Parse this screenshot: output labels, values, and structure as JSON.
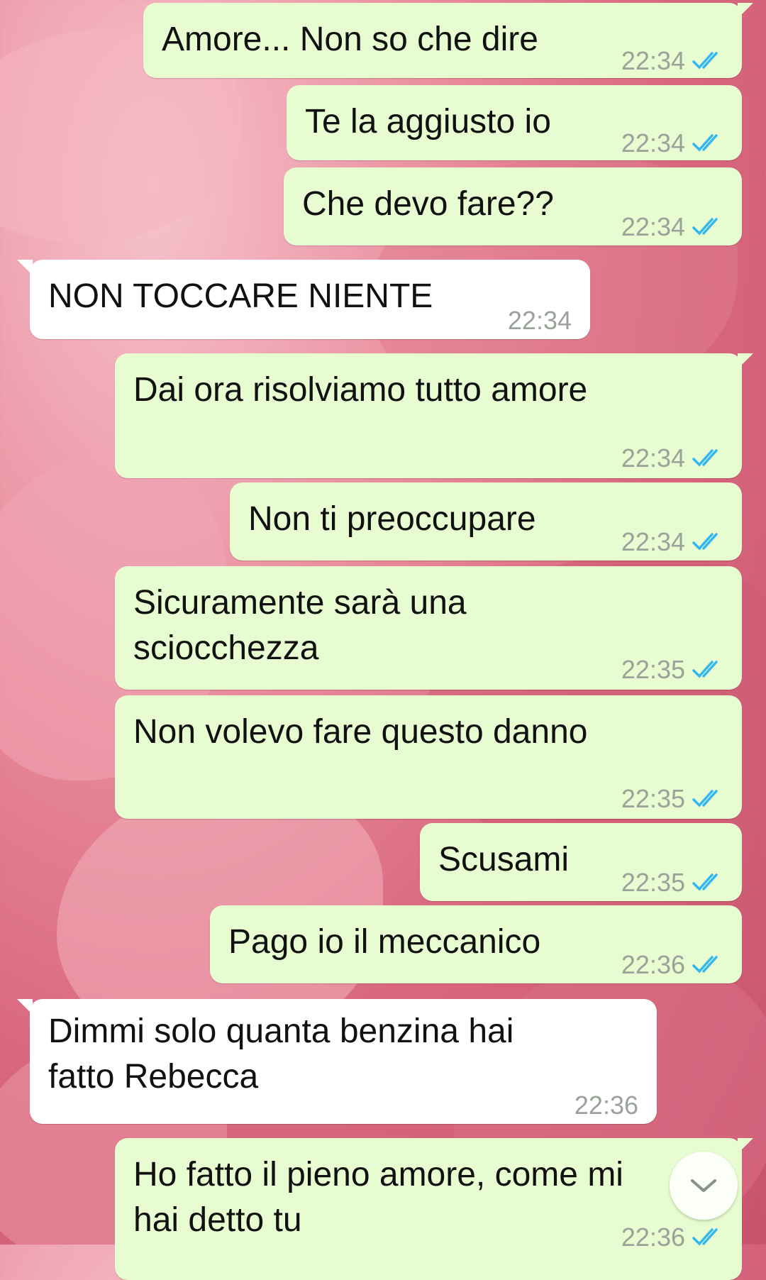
{
  "colors": {
    "outgoing": "#e7fcd1",
    "incoming": "#ffffff",
    "tick": "#34b7f1",
    "time": "#9aa29a"
  },
  "messages": [
    {
      "text": "Amore... Non so che dire",
      "time": "22:34",
      "dir": "out",
      "status": "double-check-read-icon"
    },
    {
      "text": "Te la aggiusto io",
      "time": "22:34",
      "dir": "out",
      "status": "double-check-read-icon"
    },
    {
      "text": "Che devo fare??",
      "time": "22:34",
      "dir": "out",
      "status": "double-check-read-icon"
    },
    {
      "text": "NON TOCCARE NIENTE",
      "time": "22:34",
      "dir": "in"
    },
    {
      "text": "Dai ora risolviamo tutto amore",
      "time": "22:34",
      "dir": "out",
      "status": "double-check-read-icon"
    },
    {
      "text": "Non ti preoccupare",
      "time": "22:34",
      "dir": "out",
      "status": "double-check-read-icon"
    },
    {
      "text": "Sicuramente sarà una\nsciocchezza",
      "time": "22:35",
      "dir": "out",
      "status": "double-check-read-icon"
    },
    {
      "text": "Non volevo fare questo danno",
      "time": "22:35",
      "dir": "out",
      "status": "double-check-read-icon"
    },
    {
      "text": "Scusami",
      "time": "22:35",
      "dir": "out",
      "status": "double-check-read-icon"
    },
    {
      "text": "Pago io il meccanico",
      "time": "22:36",
      "dir": "out",
      "status": "double-check-read-icon"
    },
    {
      "text": "Dimmi solo quanta benzina hai\nfatto Rebecca",
      "time": "22:36",
      "dir": "in"
    },
    {
      "text": "Ho fatto il pieno amore, come mi\nhai detto tu",
      "time": "22:36",
      "dir": "out",
      "status": "double-check-read-icon"
    }
  ],
  "scroll_button": {
    "icon": "chevron-down-icon"
  }
}
